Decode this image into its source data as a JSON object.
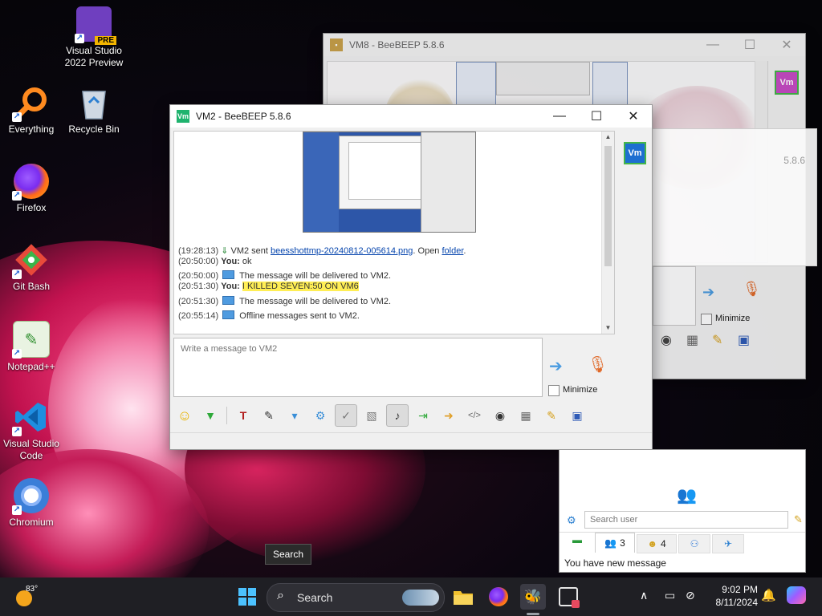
{
  "desktop": {
    "icons": [
      {
        "label": "Visual Studio 2022 Preview",
        "badge": "PRE"
      },
      {
        "label": "Everything"
      },
      {
        "label": "Recycle Bin"
      },
      {
        "label": "Firefox"
      },
      {
        "label": "Git Bash"
      },
      {
        "label": "Notepad++"
      },
      {
        "label": "Visual Studio Code"
      },
      {
        "label": "Chromium"
      }
    ]
  },
  "back_window": {
    "title": "VM8 - BeeBEEP 5.8.6",
    "avatar": "Vm",
    "minimize_label": "Minimize",
    "partial_title": "5.8.6"
  },
  "main_window": {
    "title": "VM2 - BeeBEEP 5.8.6",
    "app_icon": "Vm",
    "avatar": "Vm",
    "messages": [
      {
        "ts": "(19:28:13)",
        "pre": "VM2 sent ",
        "link": "beesshottmp-20240812-005614.png",
        "mid": ". Open ",
        "link2": "folder",
        "post": "."
      },
      {
        "ts": "(20:50:00)",
        "who": "You:",
        "text": "ok"
      },
      {
        "ts": "(20:50:00)",
        "text": "The message will be delivered to VM2."
      },
      {
        "ts": "(20:51:30)",
        "who": "You:",
        "text": "I KILLED SEVEN:50 ON VM6"
      },
      {
        "ts": "(20:51:30)",
        "text": "The message will be delivered to VM2."
      },
      {
        "ts": "(20:55:14)",
        "text": "Offline messages sent to VM2."
      }
    ],
    "compose_placeholder": "Write a message to VM2",
    "minimize_label": "Minimize"
  },
  "side_panel": {
    "search_placeholder": "Search user",
    "tabs": [
      {
        "count": "3"
      },
      {
        "count": "4"
      },
      {
        "count": ""
      },
      {
        "count": ""
      }
    ],
    "status": "You have new message"
  },
  "taskbar": {
    "weather_temp": "83°",
    "search_label": "Search",
    "tooltip": "Search",
    "time": "9:02 PM",
    "date": "8/11/2024"
  }
}
